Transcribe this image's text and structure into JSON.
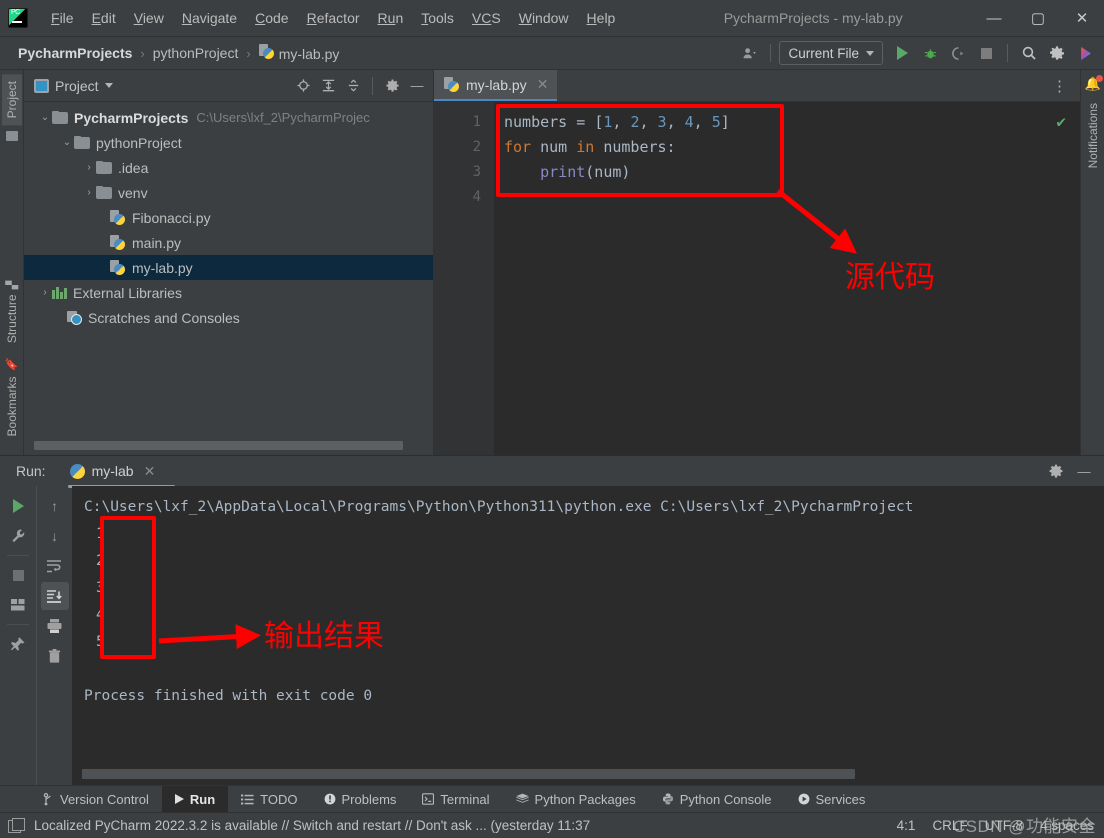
{
  "window": {
    "title": "PycharmProjects - my-lab.py",
    "logo": "pycharm-logo",
    "minimize": "—",
    "maximize": "▢",
    "close": "✕"
  },
  "menubar": {
    "items": [
      {
        "label": "File",
        "mnemonic": "F",
        "rest": "ile"
      },
      {
        "label": "Edit",
        "mnemonic": "E",
        "rest": "dit"
      },
      {
        "label": "View",
        "mnemonic": "V",
        "rest": "iew"
      },
      {
        "label": "Navigate",
        "mnemonic": "N",
        "rest": "avigate"
      },
      {
        "label": "Code",
        "mnemonic": "C",
        "rest": "ode"
      },
      {
        "label": "Refactor",
        "mnemonic": "R",
        "rest": "efactor"
      },
      {
        "label": "Run",
        "mnemonic": "Ru",
        "rest": "n"
      },
      {
        "label": "Tools",
        "mnemonic": "T",
        "rest": "ools"
      },
      {
        "label": "VCS",
        "mnemonic": "VC",
        "rest": "S"
      },
      {
        "label": "Window",
        "mnemonic": "W",
        "rest": "indow"
      },
      {
        "label": "Help",
        "mnemonic": "H",
        "rest": "elp"
      }
    ]
  },
  "navbar": {
    "breadcrumbs": [
      {
        "label": "PycharmProjects",
        "bold": true,
        "icon": ""
      },
      {
        "label": "pythonProject",
        "bold": false,
        "icon": ""
      },
      {
        "label": "my-lab.py",
        "bold": false,
        "icon": "python-file-icon"
      }
    ],
    "separator": "›",
    "run_config": "Current File",
    "icons": [
      "user-avatar-icon",
      "run-icon",
      "debug-icon",
      "run-coverage-icon",
      "stop-icon",
      "search-icon",
      "settings-icon",
      "ai-assistant-icon"
    ]
  },
  "left_rail": {
    "project_tab": "Project",
    "structure_tab": "Structure",
    "bookmarks_tab": "Bookmarks"
  },
  "right_rail": {
    "notifications_tab": "Notifications"
  },
  "project_panel": {
    "title": "Project",
    "toolbar_icons": [
      "locate-icon",
      "expand-all-icon",
      "collapse-all-icon",
      "gear-icon",
      "hide-icon"
    ],
    "tree": [
      {
        "label": "PycharmProjects",
        "path": "C:\\Users\\lxf_2\\PycharmProjec",
        "indent": 0,
        "arrow": "⌄",
        "icon": "folder-icon",
        "bold": true,
        "selected": false
      },
      {
        "label": "pythonProject",
        "path": "",
        "indent": 1,
        "arrow": "⌄",
        "icon": "folder-icon",
        "bold": false,
        "selected": false
      },
      {
        "label": ".idea",
        "path": "",
        "indent": 2,
        "arrow": "›",
        "icon": "folder-icon",
        "bold": false,
        "selected": false
      },
      {
        "label": "venv",
        "path": "",
        "indent": 2,
        "arrow": "›",
        "icon": "folder-icon",
        "bold": false,
        "selected": false
      },
      {
        "label": "Fibonacci.py",
        "path": "",
        "indent": 3,
        "arrow": "",
        "icon": "python-file-icon",
        "bold": false,
        "selected": false
      },
      {
        "label": "main.py",
        "path": "",
        "indent": 3,
        "arrow": "",
        "icon": "python-file-icon",
        "bold": false,
        "selected": false
      },
      {
        "label": "my-lab.py",
        "path": "",
        "indent": 3,
        "arrow": "",
        "icon": "python-file-icon",
        "bold": false,
        "selected": true
      },
      {
        "label": "External Libraries",
        "path": "",
        "indent": 0,
        "arrow": "›",
        "icon": "library-icon",
        "bold": false,
        "selected": false
      },
      {
        "label": "Scratches and Consoles",
        "path": "",
        "indent": 1,
        "arrow": "",
        "icon": "scratch-icon",
        "bold": false,
        "selected": false
      }
    ]
  },
  "editor": {
    "tab": {
      "label": "my-lab.py",
      "icon": "python-file-icon",
      "close": "✕"
    },
    "kebab": "⋮",
    "inspection_status": "✔",
    "line_numbers": [
      "1",
      "2",
      "3",
      "4"
    ],
    "code_lines": [
      {
        "n": 1,
        "tokens": [
          {
            "t": "numbers",
            "c": "var"
          },
          {
            "t": " = ",
            "c": "op"
          },
          {
            "t": "[",
            "c": "op"
          },
          {
            "t": "1",
            "c": "num"
          },
          {
            "t": ", ",
            "c": "op"
          },
          {
            "t": "2",
            "c": "num"
          },
          {
            "t": ", ",
            "c": "op"
          },
          {
            "t": "3",
            "c": "num"
          },
          {
            "t": ", ",
            "c": "op"
          },
          {
            "t": "4",
            "c": "num"
          },
          {
            "t": ", ",
            "c": "op"
          },
          {
            "t": "5",
            "c": "num"
          },
          {
            "t": "]",
            "c": "op"
          }
        ]
      },
      {
        "n": 2,
        "tokens": [
          {
            "t": "for",
            "c": "kw"
          },
          {
            "t": " num ",
            "c": "var"
          },
          {
            "t": "in",
            "c": "kw"
          },
          {
            "t": " numbers:",
            "c": "var"
          }
        ]
      },
      {
        "n": 3,
        "tokens": [
          {
            "t": "    ",
            "c": "var"
          },
          {
            "t": "print",
            "c": "fn"
          },
          {
            "t": "(num)",
            "c": "var"
          }
        ]
      },
      {
        "n": 4,
        "tokens": []
      }
    ]
  },
  "run_panel": {
    "label": "Run:",
    "tab": "my-lab",
    "tab_close": "✕",
    "head_icons": [
      "gear-icon",
      "hide-icon"
    ],
    "left_tools": [
      "rerun-icon",
      "wrench-icon",
      "stop-icon",
      "layout-icon",
      "pin-icon"
    ],
    "right_tools": [
      "up-arrow-icon",
      "down-arrow-icon",
      "soft-wrap-icon",
      "scroll-to-end-icon",
      "print-icon",
      "trash-icon"
    ],
    "console_lines": [
      {
        "text": "C:\\Users\\lxf_2\\AppData\\Local\\Programs\\Python\\Python311\\python.exe C:\\Users\\lxf_2\\PycharmProject",
        "kind": "cmd"
      },
      {
        "text": "1",
        "kind": "num"
      },
      {
        "text": "2",
        "kind": "num"
      },
      {
        "text": "3",
        "kind": "num"
      },
      {
        "text": "4",
        "kind": "num"
      },
      {
        "text": "5",
        "kind": "num"
      },
      {
        "text": "",
        "kind": "blank"
      },
      {
        "text": "Process finished with exit code 0",
        "kind": "fin"
      }
    ]
  },
  "toolwindow_bar": {
    "items": [
      {
        "label": "Version Control",
        "icon": "vcs-branch-icon",
        "active": false
      },
      {
        "label": "Run",
        "icon": "run-triangle-icon",
        "active": true
      },
      {
        "label": "TODO",
        "icon": "todo-list-icon",
        "active": false
      },
      {
        "label": "Problems",
        "icon": "problems-icon",
        "active": false
      },
      {
        "label": "Terminal",
        "icon": "terminal-icon",
        "active": false
      },
      {
        "label": "Python Packages",
        "icon": "packages-icon",
        "active": false
      },
      {
        "label": "Python Console",
        "icon": "python-console-icon",
        "active": false
      },
      {
        "label": "Services",
        "icon": "services-icon",
        "active": false
      }
    ]
  },
  "statusbar": {
    "icon": "event-log-icon",
    "message": "Localized PyCharm 2022.3.2 is available // Switch and restart // Don't ask ... (yesterday 11:37",
    "caret": "4:1",
    "line_sep": "CRLF",
    "encoding": "UTF-8",
    "indent": "4 spaces",
    "watermark": "CSDN @功能安全"
  },
  "annotations": {
    "code_label": "源代码",
    "output_label": "输出结果",
    "color": "#ff0000"
  }
}
